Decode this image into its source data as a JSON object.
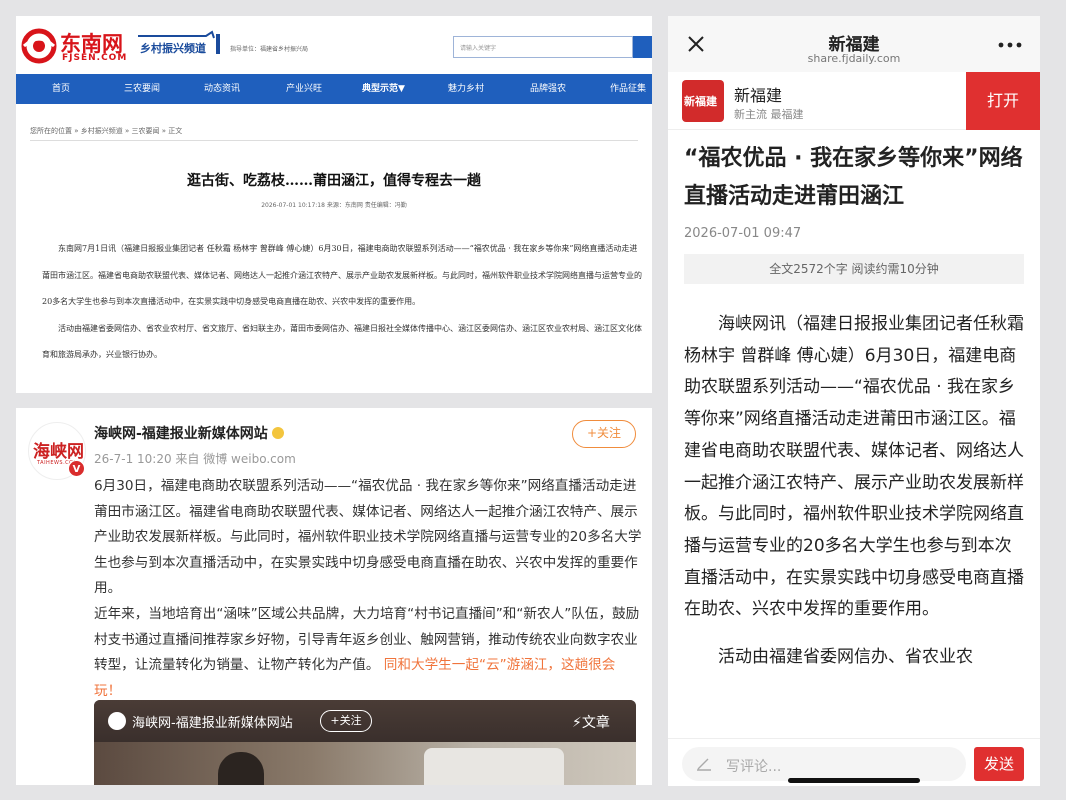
{
  "fjsen": {
    "logo_cn": "东南网",
    "logo_en": "FJSEN.COM",
    "channel_name": "乡村振兴频道",
    "sponsor": "指导单位：福建省乡村振兴局",
    "search_placeholder": "请输入关键字",
    "nav": [
      "首页",
      "三农要闻",
      "动态资讯",
      "产业兴旺",
      "典型示范▼",
      "魅力乡村",
      "品牌强农",
      "作品征集"
    ],
    "breadcrumb": "您所在的位置 » 乡村振兴频道 » 三农要闻 » 正文",
    "title": "逛古街、吃荔枝……莆田涵江，值得专程去一趟",
    "meta": "2026-07-01 10:17:18   来源：东南网   责任编辑：冯勤",
    "p1": "东南网7月1日讯（福建日报报业集团记者 任秋霜 杨林宇 曾群峰 傅心婕）6月30日，福建电商助农联盟系列活动——“福农优品 · 我在家乡等你来”网络直播活动走进莆田市涵江区。福建省电商助农联盟代表、媒体记者、网络达人一起推介涵江农特产、展示产业助农发展新样板。与此同时，福州软件职业技术学院网络直播与运营专业的20多名大学生也参与到本次直播活动中，在实景实践中切身感受电商直播在助农、兴农中发挥的重要作用。",
    "p2": "活动由福建省委网信办、省农业农村厅、省文旅厅、省妇联主办，莆田市委网信办、福建日报社全媒体传播中心、涵江区委网信办、涵江区农业农村局、涵江区文化体育和旅游局承办，兴业银行协办。"
  },
  "weibo": {
    "avatar_text": "海峡网",
    "avatar_sub": "TAIHEWS.COM",
    "verified_badge": "V",
    "account_name": "海峡网-福建报业新媒体网站",
    "post_meta": "26-7-1 10:20 来自 微博 weibo.com",
    "follow_label": "+关注",
    "text_main": "6月30日，福建电商助农联盟系列活动——“福农优品 · 我在家乡等你来”网络直播活动走进莆田市涵江区。福建省电商助农联盟代表、媒体记者、网络达人一起推介涵江农特产、展示产业助农发展新样板。与此同时，福州软件职业技术学院网络直播与运营专业的20多名大学生也参与到本次直播活动中，在实景实践中切身感受电商直播在助农、兴农中发挥的重要作用。",
    "text_second": "近年来，当地培育出“涵味”区域公共品牌，大力培育“村书记直播间”和“新农人”队伍，鼓励村支书通过直播间推荐家乡好物，引导青年返乡创业、触网营销，推动传统农业向数字农业转型，让流量转化为销量、让物产转化为产值。",
    "text_highlight": "同和大学生一起“云”游涵江，这趟很会玩！",
    "card_name": "海峡网-福建报业新媒体网站",
    "card_follow": "+关注",
    "card_tag": "⚡文章"
  },
  "mobile": {
    "title": "新福建",
    "url": "share.fjdaily.com",
    "app_icon_text": "新福建",
    "app_name": "新福建",
    "app_slogan": "新主流 最福建",
    "open_label": "打开",
    "headline": "“福农优品 · 我在家乡等你来”网络直播活动走进莆田涵江",
    "date": "2026-07-01 09:47",
    "stats": "全文2572个字 阅读约需10分钟",
    "p1": "海峡网讯（福建日报报业集团记者任秋霜 杨林宇 曾群峰 傅心婕）6月30日，福建电商助农联盟系列活动——“福农优品 · 我在家乡等你来”网络直播活动走进莆田市涵江区。福建省电商助农联盟代表、媒体记者、网络达人一起推介涵江农特产、展示产业助农发展新样板。与此同时，福州软件职业技术学院网络直播与运营专业的20多名大学生也参与到本次直播活动中，在实景实践中切身感受电商直播在助农、兴农中发挥的重要作用。",
    "p2": "活动由福建省委网信办、省农业农",
    "comment_placeholder": "写评论...",
    "send_label": "发送"
  },
  "colors": {
    "fjsen_red": "#d8141a",
    "nav_blue": "#1f5fbd",
    "weibo_orange": "#f0743c",
    "app_red": "#e03030"
  }
}
